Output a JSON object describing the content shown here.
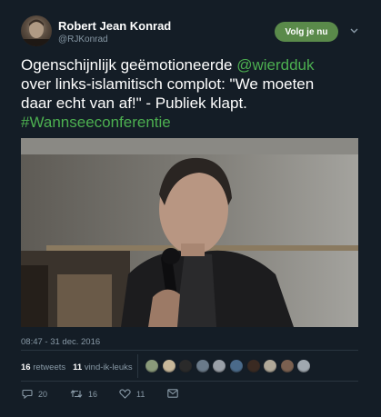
{
  "author": {
    "name": "Robert Jean Konrad",
    "handle": "@RJKonrad"
  },
  "follow_button": {
    "label": "Volg je nu"
  },
  "tweet": {
    "lines": [
      [
        {
          "t": "Ogenschijnlijk geëmotioneerde ",
          "kind": "text"
        },
        {
          "t": "@wierdduk",
          "kind": "mention"
        }
      ],
      [
        {
          "t": "over links-islamitisch complot: \"We moeten",
          "kind": "text"
        }
      ],
      [
        {
          "t": "daar echt van af!\" - Publiek klapt.",
          "kind": "text"
        }
      ],
      [
        {
          "t": "#Wannseeconferentie",
          "kind": "hashtag"
        }
      ]
    ]
  },
  "timestamp": "08:47 - 31 dec. 2016",
  "stats": {
    "retweets_count": "16",
    "retweets_label": "retweets",
    "likes_count": "11",
    "likes_label": "vind-ik-leuks"
  },
  "liker_avatars": [
    "#8a9a7a",
    "#c8b89a",
    "#2a2a2a",
    "#6a7a8a",
    "#9aa0a8",
    "#4a6a8a",
    "#3a2a22",
    "#b0a898",
    "#7a6050",
    "#a0a8b0"
  ],
  "actions": {
    "reply_count": "20",
    "retweet_count": "16",
    "like_count": "11"
  },
  "colors": {
    "background": "#141d26",
    "accent": "#4caf50",
    "follow_button": "#5a8a4a",
    "muted": "#8899a6"
  },
  "icons": [
    "chevron-down-icon",
    "reply-icon",
    "retweet-icon",
    "heart-icon",
    "message-icon"
  ]
}
